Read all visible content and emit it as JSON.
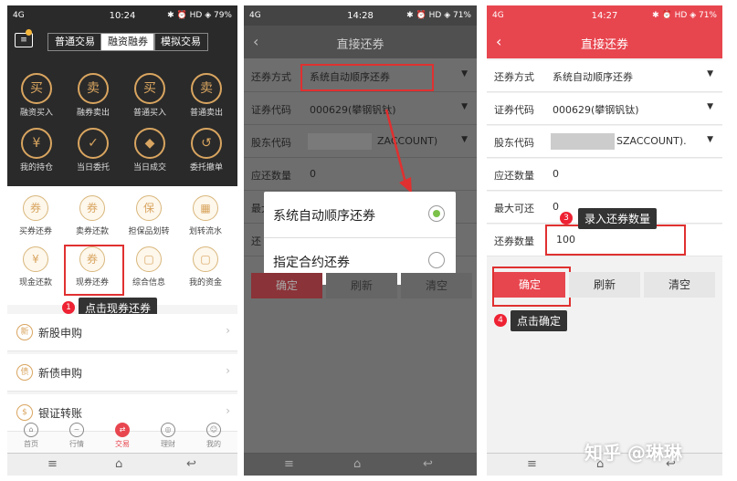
{
  "panel1": {
    "status": {
      "left": "4G",
      "time": "10:24",
      "right": "✱ ⏰ HD ◈ 79%"
    },
    "tabs": [
      "普通交易",
      "融资融券",
      "模拟交易"
    ],
    "grid_top": [
      {
        "glyph": "买",
        "label": "融资买入"
      },
      {
        "glyph": "卖",
        "label": "融券卖出"
      },
      {
        "glyph": "买",
        "label": "普通买入"
      },
      {
        "glyph": "卖",
        "label": "普通卖出"
      },
      {
        "glyph": "¥",
        "label": "我的持仓"
      },
      {
        "glyph": "✓",
        "label": "当日委托"
      },
      {
        "glyph": "◆",
        "label": "当日成交"
      },
      {
        "glyph": "↺",
        "label": "委托撤单"
      }
    ],
    "grid_mid": [
      {
        "glyph": "券",
        "label": "买券还券"
      },
      {
        "glyph": "券",
        "label": "卖券还款"
      },
      {
        "glyph": "保",
        "label": "担保品划转"
      },
      {
        "glyph": "▦",
        "label": "划转流水"
      },
      {
        "glyph": "¥",
        "label": "现金还款"
      },
      {
        "glyph": "券",
        "label": "现券还券"
      },
      {
        "glyph": "▢",
        "label": "综合信息"
      },
      {
        "glyph": "▢",
        "label": "我的资金"
      }
    ],
    "list": [
      {
        "glyph": "新",
        "label": "新股申购"
      },
      {
        "glyph": "债",
        "label": "新债申购"
      },
      {
        "glyph": "$",
        "label": "银证转账"
      }
    ],
    "bottom_tabs": [
      {
        "glyph": "⌂",
        "label": "首页"
      },
      {
        "glyph": "~",
        "label": "行情"
      },
      {
        "glyph": "⇄",
        "label": "交易"
      },
      {
        "glyph": "◎",
        "label": "理财"
      },
      {
        "glyph": "☺",
        "label": "我的"
      }
    ],
    "callout": {
      "num": "1",
      "text": "点击现券还券"
    }
  },
  "panel2": {
    "status": {
      "left": "4G",
      "time": "14:28",
      "right": "✱ ⏰ HD ◈ 71%"
    },
    "title": "直接还券",
    "rows": [
      {
        "label": "还券方式",
        "value": "系统自动顺序还券"
      },
      {
        "label": "证券代码",
        "value": "000629(攀钢钒钛)"
      },
      {
        "label": "股东代码",
        "value": "ZACCOUNT)"
      },
      {
        "label": "应还数量",
        "value": "0"
      },
      {
        "label": "最大",
        "value": ""
      },
      {
        "label": "还",
        "value": ""
      }
    ],
    "popup": [
      "系统自动顺序还券",
      "指定合约还券"
    ],
    "buttons": [
      "确定",
      "刷新",
      "清空"
    ]
  },
  "panel3": {
    "status": {
      "left": "4G",
      "time": "14:27",
      "right": "✱ ⏰ HD ◈ 71%"
    },
    "title": "直接还券",
    "rows": [
      {
        "label": "还券方式",
        "value": "系统自动顺序还券"
      },
      {
        "label": "证券代码",
        "value": "000629(攀钢钒钛)"
      },
      {
        "label": "股东代码",
        "value": "SZACCOUNT)."
      },
      {
        "label": "应还数量",
        "value": "0"
      },
      {
        "label": "最大可还",
        "value": "0"
      },
      {
        "label": "还券数量",
        "value": "100"
      }
    ],
    "buttons": [
      "确定",
      "刷新",
      "清空"
    ],
    "callout3": {
      "num": "3",
      "text": "录入还券数量"
    },
    "callout4": {
      "num": "4",
      "text": "点击确定"
    }
  },
  "watermark": "知乎 @琳琳",
  "colors": {
    "accent": "#e8464f",
    "gold": "#d9a560",
    "dark": "#2a2a2a"
  }
}
